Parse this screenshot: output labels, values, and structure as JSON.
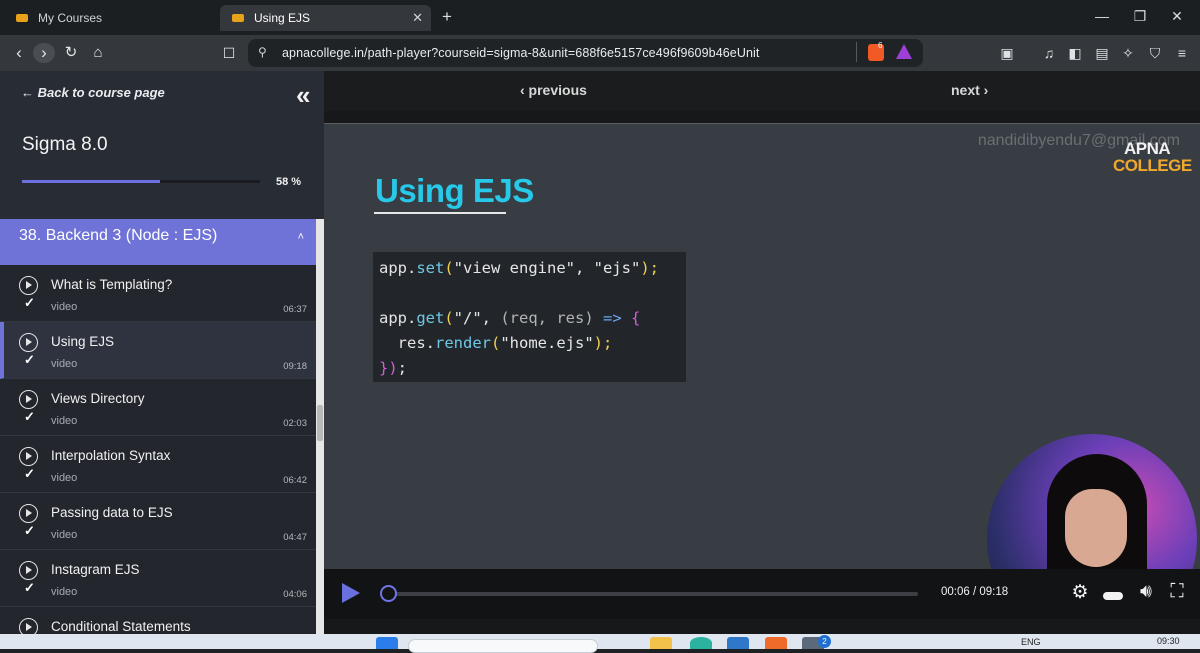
{
  "browser": {
    "tabs": [
      {
        "label": "My Courses",
        "active": false
      },
      {
        "label": "Using EJS",
        "active": true
      }
    ],
    "new_tab": "+",
    "url": "apnacollege.in/path-player?courseid=sigma-8&unit=688f6e5157ce496f9609b46eUnit",
    "shield_badge": "6",
    "window_controls": {
      "minimize": "—",
      "maximize": "❐",
      "close": "✕"
    }
  },
  "sidebar": {
    "back_label": "← Back to course page",
    "collapse_icon": "«",
    "course_title": "Sigma 8.0",
    "progress_percent": 58,
    "progress_label": "58 %",
    "section": {
      "title": "38. Backend 3 (Node : EJS)",
      "chevron": "˄"
    },
    "lessons": [
      {
        "title": "What is Templating?",
        "type": "video",
        "duration": "06:37",
        "active": false
      },
      {
        "title": "Using EJS",
        "type": "video",
        "duration": "09:18",
        "active": true
      },
      {
        "title": "Views Directory",
        "type": "video",
        "duration": "02:03",
        "active": false
      },
      {
        "title": "Interpolation Syntax",
        "type": "video",
        "duration": "06:42",
        "active": false
      },
      {
        "title": "Passing data to EJS",
        "type": "video",
        "duration": "04:47",
        "active": false
      },
      {
        "title": "Instagram EJS",
        "type": "video",
        "duration": "04:06",
        "active": false
      },
      {
        "title": "Conditional Statements",
        "type": "video",
        "duration": "",
        "active": false
      }
    ]
  },
  "main": {
    "previous_label": "‹ previous",
    "next_label": "next ›",
    "video": {
      "watermark": "nandidibyendu7@gmail.com",
      "brand_top": "APNA",
      "brand_bottom": "COLLEGE",
      "slide_title": "Using EJS",
      "code": {
        "l1_obj": "app.",
        "l1_fn": "set",
        "l1_open": "(",
        "l1_args": "\"view engine\", \"ejs\"",
        "l1_close": ");",
        "l2_obj": "app.",
        "l2_fn": "get",
        "l2_open": "(",
        "l2_path": "\"/\", ",
        "l2_params": "(req, res)",
        "l2_arrow": " => ",
        "l2_brace": "{",
        "l3_obj": "  res.",
        "l3_fn": "render",
        "l3_open": "(",
        "l3_arg": "\"home.ejs\"",
        "l3_close": ");",
        "l4_close": "})",
        "l4_semi": ";"
      }
    },
    "controls": {
      "time": "00:06 / 09:18",
      "position_seconds": 6,
      "duration_seconds": 558
    }
  },
  "taskbar": {
    "language": "ENG",
    "clock": "09:30",
    "badge_count": "2"
  },
  "colors": {
    "accent": "#6f72d6",
    "slide_title": "#27c8e8",
    "brand_orange": "#f0a92d"
  }
}
